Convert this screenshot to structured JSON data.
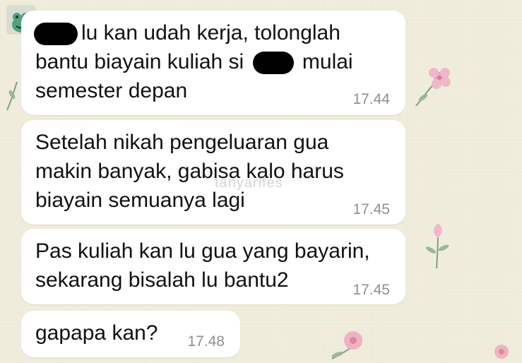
{
  "chat": {
    "messages": [
      {
        "before_redaction": "",
        "line1_after": "lu kan udah kerja, tolonglah",
        "line2_before": "bantu biayain kuliah si",
        "line2_after": "mulai",
        "line3": "semester depan",
        "time": "17.44"
      },
      {
        "line1": "Setelah nikah pengeluaran gua",
        "line2": "makin banyak, gabisa kalo harus",
        "line3": "biayain semuanya lagi",
        "time": "17.45"
      },
      {
        "line1": "Pas kuliah kan lu gua yang bayarin,",
        "line2": "sekarang bisalah lu bantu2",
        "time": "17.45"
      },
      {
        "line1": "gapapa kan?",
        "time": "17.48"
      }
    ]
  },
  "watermark": "tanyarlfes",
  "colors": {
    "bubble": "#ffffff",
    "background": "#f1eedd",
    "timestamp": "#8f8f8f",
    "flower": "#e8a2b8"
  },
  "icons": {
    "avatar": "green-frog-avatar-icon",
    "redaction": "black-scribble-redaction"
  }
}
